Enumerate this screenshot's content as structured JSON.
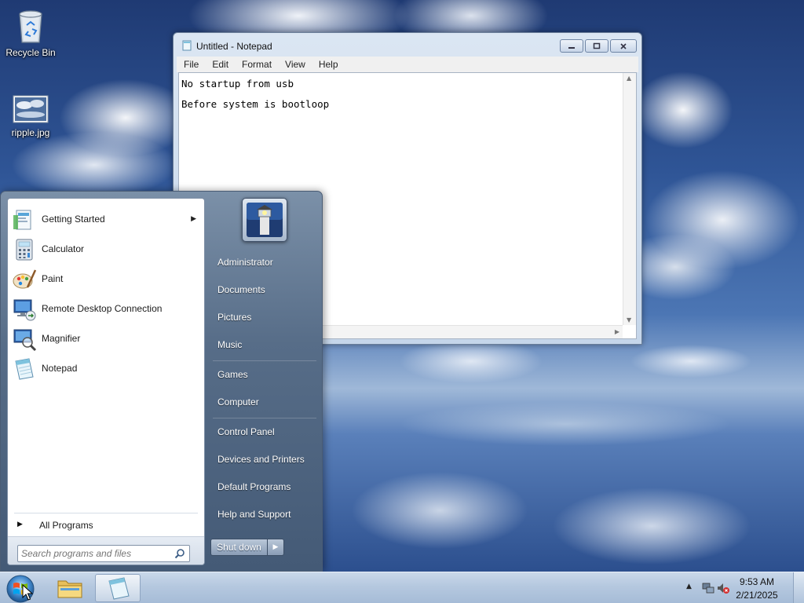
{
  "desktop": {
    "icons": [
      {
        "label": "Recycle Bin",
        "icon": "recycle-bin-icon"
      },
      {
        "label": "ripple.jpg",
        "icon": "image-file-icon"
      }
    ]
  },
  "notepad": {
    "title": "Untitled - Notepad",
    "menu": [
      "File",
      "Edit",
      "Format",
      "View",
      "Help"
    ],
    "content": "No startup from usb\nBefore system is bootloop"
  },
  "start_menu": {
    "programs": [
      {
        "label": "Getting Started",
        "icon": "getting-started-icon",
        "submenu": true
      },
      {
        "label": "Calculator",
        "icon": "calculator-icon"
      },
      {
        "label": "Paint",
        "icon": "paint-icon"
      },
      {
        "label": "Remote Desktop Connection",
        "icon": "remote-desktop-icon"
      },
      {
        "label": "Magnifier",
        "icon": "magnifier-icon"
      },
      {
        "label": "Notepad",
        "icon": "notepad-icon"
      }
    ],
    "all_programs": "All Programs",
    "search_placeholder": "Search programs and files",
    "right_links": [
      "Administrator",
      "Documents",
      "Pictures",
      "Music",
      "Games",
      "Computer",
      "Control Panel",
      "Devices and Printers",
      "Default Programs",
      "Help and Support"
    ],
    "shutdown_label": "Shut down"
  },
  "taskbar": {
    "time": "9:53 AM",
    "date": "2/21/2025"
  }
}
